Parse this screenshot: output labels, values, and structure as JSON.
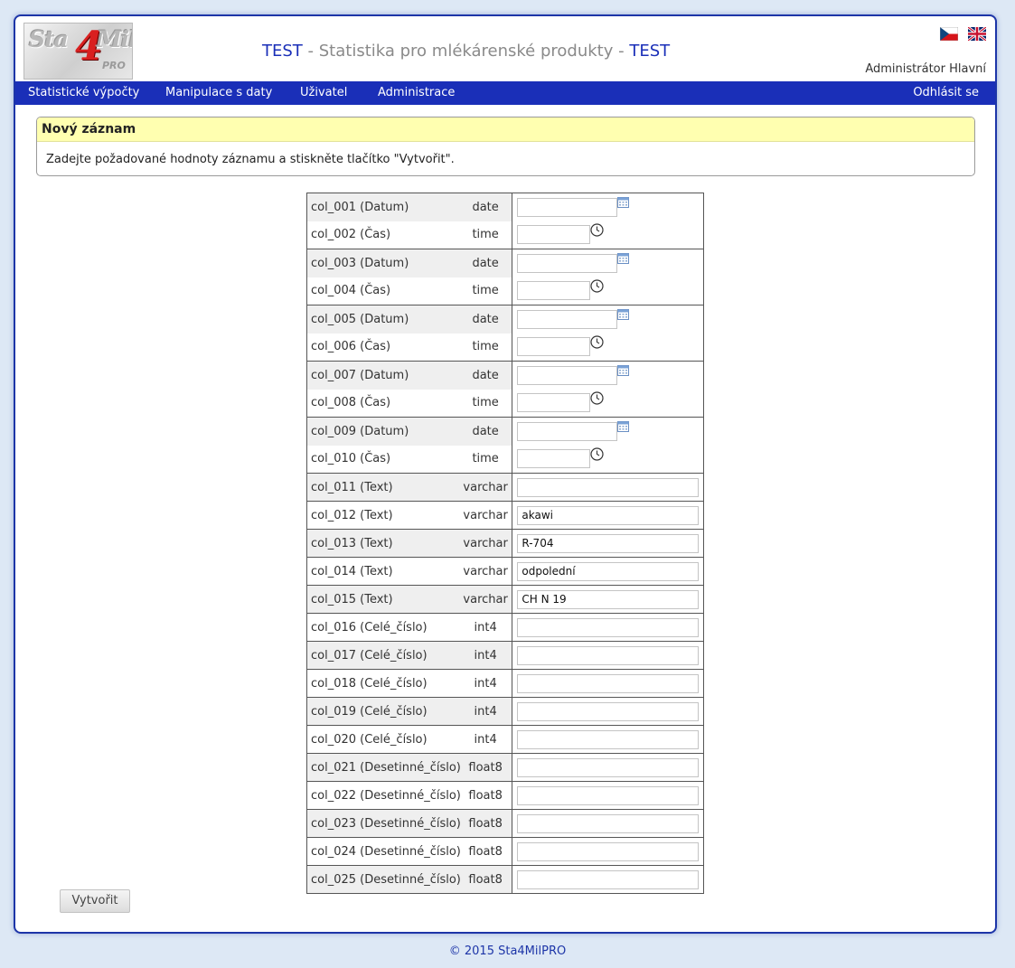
{
  "header": {
    "logo_text": "Sta4Mil PRO",
    "title_prefix": "TEST",
    "title_separator1": " - ",
    "title_main": "Statistika pro mlékárenské produkty",
    "title_separator2": " - ",
    "title_suffix": "TEST",
    "user_name": "Administrátor Hlavní"
  },
  "menu": {
    "items": [
      "Statistické výpočty",
      "Manipulace s daty",
      "Uživatel",
      "Administrace"
    ],
    "logout": "Odhlásit se"
  },
  "panel": {
    "title": "Nový záznam",
    "message": "Zadejte požadované hodnoty záznamu a stiskněte tlačítko \"Vytvořit\"."
  },
  "fields": [
    {
      "label": "col_001 (Datum)",
      "type": "date",
      "value": ""
    },
    {
      "label": "col_002 (Čas)",
      "type": "time",
      "value": ""
    },
    {
      "label": "col_003 (Datum)",
      "type": "date",
      "value": ""
    },
    {
      "label": "col_004 (Čas)",
      "type": "time",
      "value": ""
    },
    {
      "label": "col_005 (Datum)",
      "type": "date",
      "value": ""
    },
    {
      "label": "col_006 (Čas)",
      "type": "time",
      "value": ""
    },
    {
      "label": "col_007 (Datum)",
      "type": "date",
      "value": ""
    },
    {
      "label": "col_008 (Čas)",
      "type": "time",
      "value": ""
    },
    {
      "label": "col_009 (Datum)",
      "type": "date",
      "value": ""
    },
    {
      "label": "col_010 (Čas)",
      "type": "time",
      "value": ""
    },
    {
      "label": "col_011 (Text)",
      "type": "varchar",
      "value": ""
    },
    {
      "label": "col_012 (Text)",
      "type": "varchar",
      "value": "akawi"
    },
    {
      "label": "col_013 (Text)",
      "type": "varchar",
      "value": "R-704"
    },
    {
      "label": "col_014 (Text)",
      "type": "varchar",
      "value": "odpolední"
    },
    {
      "label": "col_015 (Text)",
      "type": "varchar",
      "value": "CH N 19"
    },
    {
      "label": "col_016 (Celé_číslo)",
      "type": "int4",
      "value": ""
    },
    {
      "label": "col_017 (Celé_číslo)",
      "type": "int4",
      "value": ""
    },
    {
      "label": "col_018 (Celé_číslo)",
      "type": "int4",
      "value": ""
    },
    {
      "label": "col_019 (Celé_číslo)",
      "type": "int4",
      "value": ""
    },
    {
      "label": "col_020 (Celé_číslo)",
      "type": "int4",
      "value": ""
    },
    {
      "label": "col_021 (Desetinné_číslo)",
      "type": "float8",
      "value": ""
    },
    {
      "label": "col_022 (Desetinné_číslo)",
      "type": "float8",
      "value": ""
    },
    {
      "label": "col_023 (Desetinné_číslo)",
      "type": "float8",
      "value": ""
    },
    {
      "label": "col_024 (Desetinné_číslo)",
      "type": "float8",
      "value": ""
    },
    {
      "label": "col_025 (Desetinné_číslo)",
      "type": "float8",
      "value": ""
    }
  ],
  "create_button": "Vytvořit",
  "footer": "© 2015 Sta4MilPRO",
  "colors": {
    "brand_blue": "#1a2fb8",
    "panel_header": "#ffffb0",
    "logo_red": "#d92020"
  }
}
